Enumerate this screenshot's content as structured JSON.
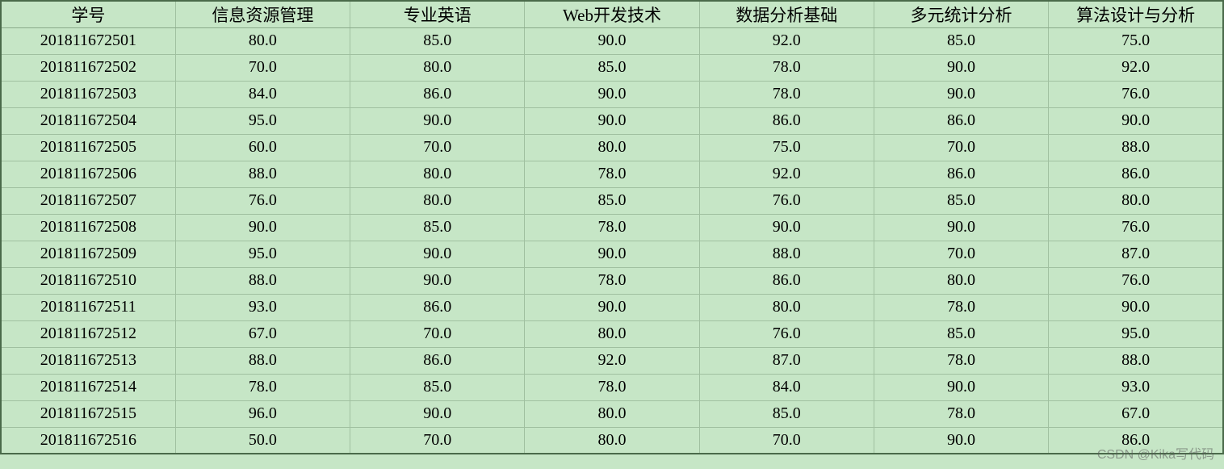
{
  "table": {
    "headers": [
      "学号",
      "信息资源管理",
      "专业英语",
      "Web开发技术",
      "数据分析基础",
      "多元统计分析",
      "算法设计与分析"
    ],
    "rows": [
      [
        "201811672501",
        "80.0",
        "85.0",
        "90.0",
        "92.0",
        "85.0",
        "75.0"
      ],
      [
        "201811672502",
        "70.0",
        "80.0",
        "85.0",
        "78.0",
        "90.0",
        "92.0"
      ],
      [
        "201811672503",
        "84.0",
        "86.0",
        "90.0",
        "78.0",
        "90.0",
        "76.0"
      ],
      [
        "201811672504",
        "95.0",
        "90.0",
        "90.0",
        "86.0",
        "86.0",
        "90.0"
      ],
      [
        "201811672505",
        "60.0",
        "70.0",
        "80.0",
        "75.0",
        "70.0",
        "88.0"
      ],
      [
        "201811672506",
        "88.0",
        "80.0",
        "78.0",
        "92.0",
        "86.0",
        "86.0"
      ],
      [
        "201811672507",
        "76.0",
        "80.0",
        "85.0",
        "76.0",
        "85.0",
        "80.0"
      ],
      [
        "201811672508",
        "90.0",
        "85.0",
        "78.0",
        "90.0",
        "90.0",
        "76.0"
      ],
      [
        "201811672509",
        "95.0",
        "90.0",
        "90.0",
        "88.0",
        "70.0",
        "87.0"
      ],
      [
        "201811672510",
        "88.0",
        "90.0",
        "78.0",
        "86.0",
        "80.0",
        "76.0"
      ],
      [
        "201811672511",
        "93.0",
        "86.0",
        "90.0",
        "80.0",
        "78.0",
        "90.0"
      ],
      [
        "201811672512",
        "67.0",
        "70.0",
        "80.0",
        "76.0",
        "85.0",
        "95.0"
      ],
      [
        "201811672513",
        "88.0",
        "86.0",
        "92.0",
        "87.0",
        "78.0",
        "88.0"
      ],
      [
        "201811672514",
        "78.0",
        "85.0",
        "78.0",
        "84.0",
        "90.0",
        "93.0"
      ],
      [
        "201811672515",
        "96.0",
        "90.0",
        "80.0",
        "85.0",
        "78.0",
        "67.0"
      ],
      [
        "201811672516",
        "50.0",
        "70.0",
        "80.0",
        "70.0",
        "90.0",
        "86.0"
      ]
    ]
  },
  "watermark": "CSDN @Kika写代码"
}
